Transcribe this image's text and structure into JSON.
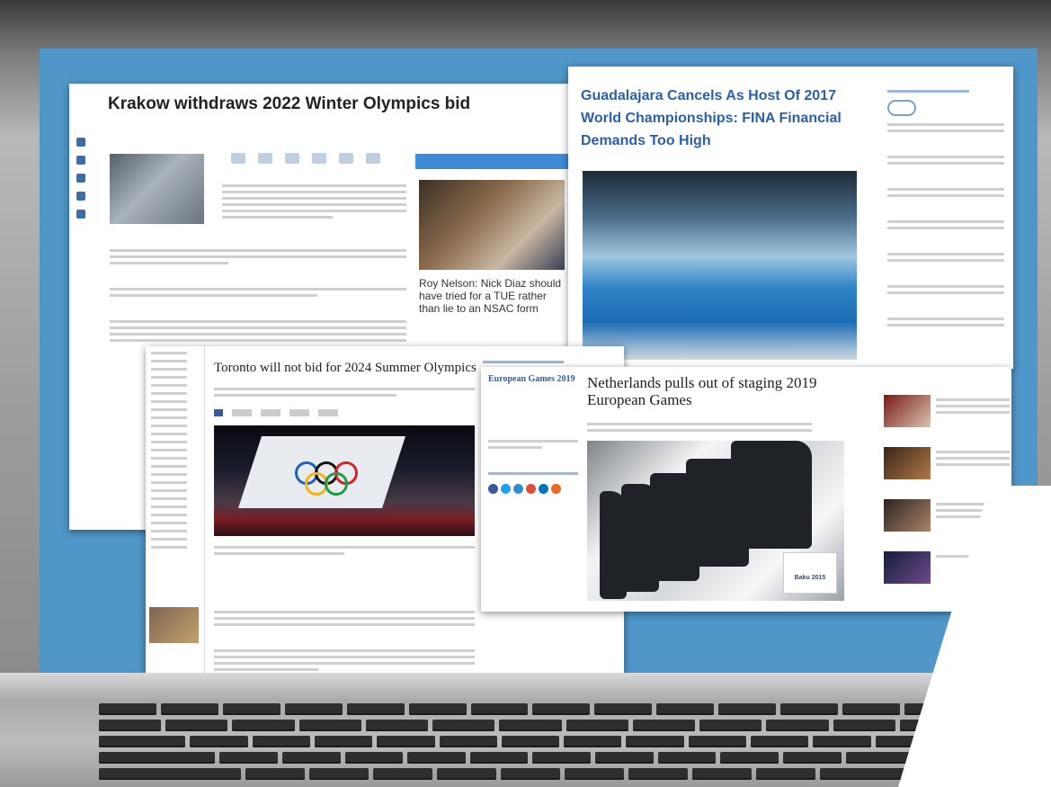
{
  "cards": {
    "krakow": {
      "title": "Krakow withdraws 2022 Winter Olympics bid",
      "caption": "Roy Nelson: Nick Diaz should have tried for a TUE rather than lie to an NSAC form"
    },
    "guadalajara": {
      "title": "Guadalajara Cancels As Host Of 2017 World Championships: FINA Financial Demands Too High"
    },
    "toronto": {
      "title": "Toronto will not bid for 2024 Summer Olympics"
    },
    "netherlands": {
      "title": "Netherlands pulls out of staging 2019 European Games",
      "side_title": "European Games 2019",
      "badge": "Baku 2015"
    }
  },
  "colors": {
    "screen": "#4f97c9",
    "link_blue": "#2b5fa8",
    "share_dots": [
      "#3b5998",
      "#1da1f2",
      "#2e8ece",
      "#dd4b39",
      "#0077b5",
      "#f26522"
    ]
  }
}
